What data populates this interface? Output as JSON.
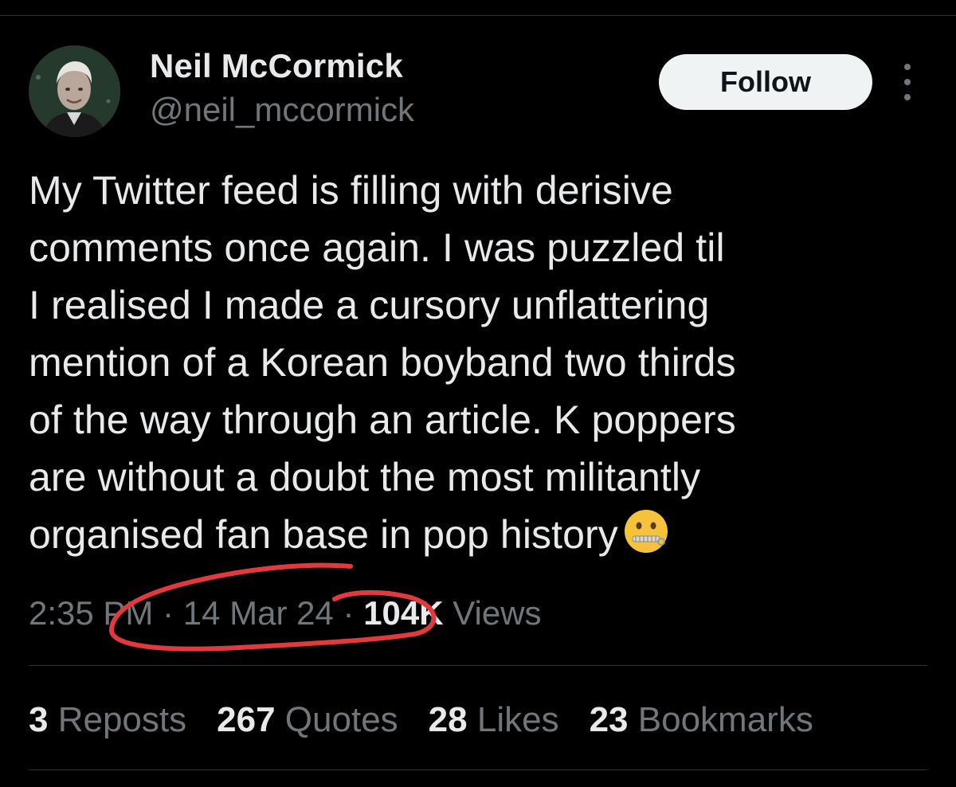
{
  "author": {
    "name": "Neil McCormick",
    "handle": "@neil_mccormick"
  },
  "actions": {
    "follow_label": "Follow",
    "more_icon": "more-vertical-icon"
  },
  "tweet": {
    "lines": [
      "My Twitter feed is filling with derisive",
      "comments once again. I was puzzled til",
      "I realised I made a cursory unflattering",
      "mention of a Korean boyband two thirds",
      "of the way through an article. K poppers",
      "are without a doubt the most militantly",
      "organised fan base in pop history"
    ],
    "emoji": "zipper-mouth-face-icon"
  },
  "meta": {
    "time": "2:35 PM",
    "sep1": " · ",
    "date": "14 Mar 24",
    "sep2": " · ",
    "views_count": "104K",
    "views_label": " Views"
  },
  "stats": [
    {
      "num": "3",
      "label": "Reposts"
    },
    {
      "num": "267",
      "label": "Quotes"
    },
    {
      "num": "28",
      "label": "Likes"
    },
    {
      "num": "23",
      "label": "Bookmarks"
    }
  ],
  "colors": {
    "background": "#000000",
    "text_primary": "#e7e9ea",
    "text_secondary": "#71767b",
    "follow_bg": "#eff3f4",
    "annotation": "#e03a3e"
  }
}
